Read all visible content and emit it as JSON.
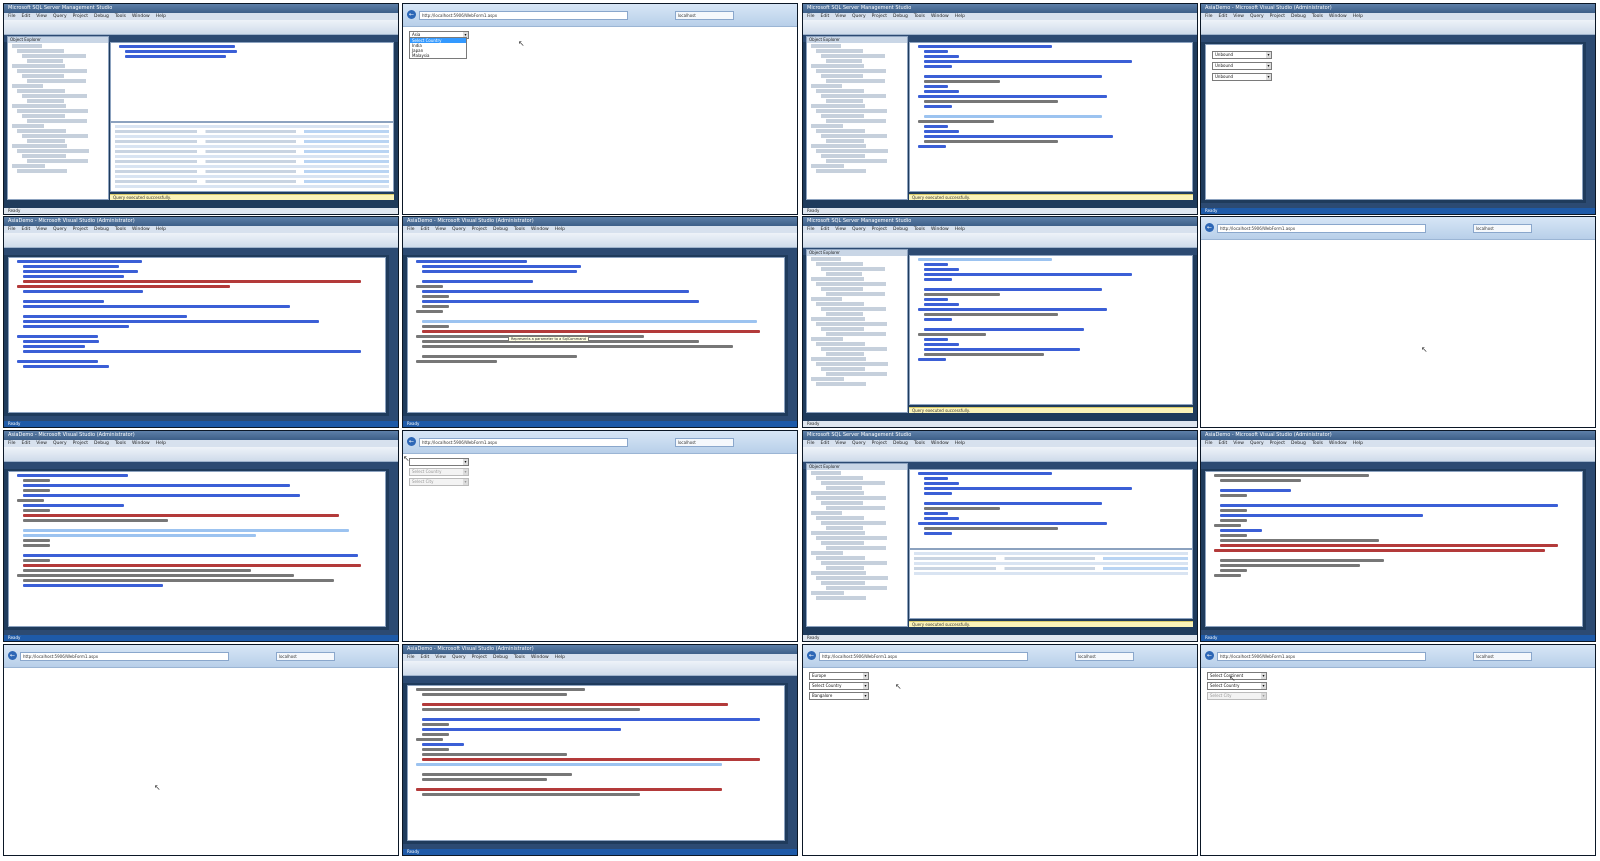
{
  "tiles": [
    {
      "app": "ssms",
      "title": "Microsoft SQL Server Management Studio",
      "tabs": [
        "SQLQuery1.sql - (local) Sample (PRAGIM\\Prashant (55))*"
      ],
      "code_lines": [
        "Select * from tblContinents",
        "Select * from tblCountries",
        "Select * from tblCities"
      ],
      "results_headers": [
        "ContinentId",
        "ContinentName"
      ],
      "results_rows": [
        [
          "1",
          "Asia"
        ],
        [
          "2",
          "Europe"
        ],
        [
          "3",
          "South America"
        ]
      ],
      "results2_headers": [
        "CountryId",
        "CountryName",
        "ContinentId"
      ],
      "results2_rows": [
        [
          "1",
          "India",
          "1"
        ],
        [
          "2",
          "Japan",
          "1"
        ],
        [
          "3",
          "Malaysia",
          "1"
        ],
        [
          "4",
          "United Kingdom",
          "2"
        ],
        [
          "5",
          "France",
          "2"
        ],
        [
          "6",
          "Germany",
          "2"
        ],
        [
          "7",
          "Argentina",
          "3"
        ],
        [
          "8",
          "Brazil",
          "3"
        ]
      ],
      "message": "Query executed successfully."
    },
    {
      "app": "browser",
      "address": "http://localhost:5906/WebForm1.aspx",
      "tab": "localhost",
      "ddl": [
        {
          "text": "Asia",
          "disabled": false
        }
      ],
      "list": [
        "Select Country",
        "India",
        "Japan",
        "Malaysia"
      ]
    },
    {
      "app": "ssms",
      "title": "Microsoft SQL Server Management Studio",
      "tabs": [
        "SQLQuery2.sql - (local).Sample (PRAGIM\\Prashant (52))*"
      ],
      "code_lines": [
        "Create Procedure spGetContinents",
        "as",
        "Begin",
        "Select ContinentId, ContinentName from tblContinents",
        "End",
        "",
        "Create Procedure spGetCountriesByContinentId",
        "@ContinentId int",
        "as",
        "Begin",
        "Select CountryId, CountryName from tblCountries",
        "where ContinentId = @ContinentId",
        "End",
        "",
        "Create Procedure spGetCountriesByContinentId",
        "@ContinentId int",
        "as",
        "Begin",
        "Select CountryId, CountryName from tblCountries",
        "where ContinentId = @ContinentId",
        "End"
      ],
      "message": "Query executed successfully."
    },
    {
      "app": "vs",
      "title": "AsiaDemo - Microsoft Visual Studio (Administrator)",
      "tabs": [
        "WebForm1.aspx",
        "WebForm1.aspx.cs"
      ],
      "design_ddl": [
        "Unbound",
        "Unbound",
        "Unbound"
      ]
    },
    {
      "app": "vs",
      "title": "AsiaDemo - Microsoft Visual Studio (Administrator)",
      "tabs": [
        "Web.config",
        "WebForm1.aspx.cs",
        "WebForm1.aspx"
      ],
      "code_lines": [
        "<?xml version=\"1.0\"?>",
        "<configuration>",
        "<connectionStrings>",
        "<add name=\"DBCS\"",
        "connectionString=\"data source=.; database = Sample; integrated security=SSPI\"",
        "providerName=\"System.Data.SqlClient\" />",
        "</connectionStrings>",
        "",
        "<system.web>",
        "<compilation debug=\"true\" targetFramework=\"4.0\" />",
        "",
        "<authentication mode=\"Forms\">",
        "<forms loginUrl=\"~/Account/Login.aspx\" timeout=\"2880\" />",
        "</authentication>",
        "",
        "<membership>",
        "<providers>",
        "<clear/>",
        "<add name=\"AspNetSqlMembershipProvider\" type=\"System.Web.Security.SqlMembershipProvider\"",
        "",
        "</providers>",
        "</membership>"
      ]
    },
    {
      "app": "vs",
      "title": "AsiaDemo - Microsoft Visual Studio (Administrator)",
      "tabs": [
        "WebForm1.aspx.cs",
        "WebForm1.aspx",
        "Web.config"
      ],
      "code_lines": [
        "using System.Data;",
        "using System.Data.SqlClient;",
        "using System.Configuration;",
        "",
        "namespace AsiaDemo",
        "{",
        "public partial class WebForm1 : System.Web.UI.Page",
        "{",
        "protected void Page_Load(object sender, EventArgs e)",
        "{",
        "}",
        "",
        "private DataSet GetData(string SPName, SqlParameter SPParameter)",
        "{",
        "string CS = ConfigurationManager.ConnectionStrings[\"DBCS\"].ConnectionString;",
        "SqlConnection con = new SqlConnection(CS);",
        "SqlDataAdapter da = new SqlDataAdapter(SPName, con);",
        "da.SelectCommand.CommandType = CommandType.StoredProcedure;",
        "",
        "DataSet DS = new DataSet();",
        "da.Fill(DS);"
      ],
      "tooltip": "Represents a parameter to a SqlCommand"
    },
    {
      "app": "ssms",
      "title": "Microsoft SQL Server Management Studio",
      "tabs": [
        "SQLQuery2.sql - (local).Sample (PRAGIM\\Prashant (52))*"
      ],
      "code_lines": [
        "Create Procedure spGetContinents",
        "as",
        "Begin",
        "Select ContinentId, ContinentName from tblContinents",
        "End",
        "",
        "Create Procedure spGetCountriesByContinentId",
        "@ContinentId int",
        "as",
        "Begin",
        "Select CountryId, CountryName from tblCountries",
        "where ContinentId = @ContinentId",
        "End",
        "",
        "Create Procedure spGetCitiesByCountryId",
        "@CountryId int",
        "as",
        "Begin",
        "Select CityId, CityName from tblCities",
        "where CountryId = @CountryId",
        "End"
      ],
      "message": "Query executed successfully."
    },
    {
      "app": "browser",
      "address": "http://localhost:5906/WebForm1.aspx",
      "tab": "localhost",
      "ddl": [],
      "list": []
    },
    {
      "app": "vs",
      "title": "AsiaDemo - Microsoft Visual Studio (Administrator)",
      "tabs": [
        "WebForm1.aspx.cs",
        "WebForm1.aspx"
      ],
      "code_lines": [
        "namespace AsiaDemo",
        "{",
        "public partial class WebForm1 : System.Web.UI.Page",
        "{",
        "protected void Page_Load(object sender, EventArgs e)",
        "{",
        "if (!IsPostBack)",
        "{",
        "ddlContinents.DataSource = GetData(\"spGetContinents\", null);",
        "ddlContinents.DataBind();",
        "",
        "ListItem liContinent = new ListItem(\"Select Continent\", \"-1\");",
        "ddlContinents.Items.Insert(0, liContinent);",
        "}",
        "}",
        "",
        "private DataSet GetData(string SPName, SqlParameter SPParameter)",
        "{",
        "string CS = ConfigurationManager.ConnectionStrings[\"DBCS\"].ConnectionString;",
        "SqlConnection con = new SqlConnection(CS);",
        "SqlDataAdapter da = new SqlDataAdapter(SPName, con);",
        "da.SelectCommand.CommandType = CommandType.StoredProcedure;",
        "if (SPParameter != null)"
      ]
    },
    {
      "app": "browser",
      "address": "http://localhost:5906/WebForm1.aspx",
      "tab": "localhost",
      "ddl": [
        {
          "text": "",
          "disabled": false
        },
        {
          "text": "Select Country",
          "disabled": true
        },
        {
          "text": "Select City",
          "disabled": true
        }
      ],
      "list": []
    },
    {
      "app": "ssms",
      "title": "Microsoft SQL Server Management Studio",
      "tabs": [
        "SQLQuery2.sql - (local).Sample (PRAGIM\\Prashant (52))*"
      ],
      "code_lines": [
        "Create Procedure spGetContinents",
        "as",
        "Begin",
        "Select ContinentId, ContinentName from tblContinents",
        "End",
        "",
        "Create Procedure spGetCountriesByContinentId",
        "@ContinentId int",
        "as",
        "Begin",
        "Select CountryId, CountryName from tblCountries",
        "where ContinentId = @ContinentId",
        "End"
      ],
      "results_headers": [
        "ContinentId",
        "ContinentName"
      ],
      "results_rows": [
        [
          "1",
          "Asia"
        ],
        [
          "2",
          "Europe"
        ],
        [
          "3",
          "South America"
        ]
      ],
      "message": "Query executed successfully."
    },
    {
      "app": "vs",
      "title": "AsiaDemo - Microsoft Visual Studio (Administrator)",
      "tabs": [
        "WebForm1.aspx.cs",
        "WebForm1.aspx"
      ],
      "code_lines": [
        "DataSet DS = new DataSet();",
        "da.Fill(DS);",
        "",
        "return DS;",
        "}",
        "",
        "protected void ddlContinents_SelectedIndexChanged(object sender, EventArgs e)",
        "{",
        "if (ddlContinents.SelectedIndex == 0)",
        "{",
        "}",
        "else",
        "{",
        "ddlCountries.Enabled = true;",
        "SqlParameter parameter = new SqlParameter(\"@ContinentId\", ddlContinents.SelectedValue);",
        "DataSet DS = GetData(\"spGetCountriesByContinentId\", parameter);",
        "",
        "ddlCountries.DataSource = DS;",
        "ddlCountries.DataBind();",
        "}",
        "}"
      ]
    },
    {
      "app": "browser",
      "address": "http://localhost:5906/WebForm1.aspx",
      "tab": "localhost",
      "ddl": [],
      "list": []
    },
    {
      "app": "vs",
      "title": "AsiaDemo - Microsoft Visual Studio (Administrator)",
      "tabs": [
        "WebForm1.aspx.cs",
        "WebForm1.aspx"
      ],
      "code_lines": [
        "ddlContinents.DataSource = DS;",
        "ddlContinents.DataBind();",
        "",
        "ListItem liCountry = new ListItem(\"Select Country\", \"-1\");",
        "ddlCountries.Items.Insert(0, liCountry);",
        "",
        "protected void ddlCountries_SelectedIndexChanged(object sender, EventArgs e)",
        "{",
        "if (ddlCountries.SelectedIndex == 0)",
        "{",
        "}",
        "else",
        "{",
        "ddlCities.Enabled = true;",
        "SqlParameter parameter = new SqlParameter(\"@CountryId\", ddlCountries.SelectedValue);",
        "DataSet DS = GetData(\"spGetCitiesByCountryId\", parameter);",
        "",
        "ddlCities.DataSource = DS;",
        "ddlCities.DataBind();",
        "",
        "ListItem liCountry = new ListItem(\"Select Country\", \"-1\");",
        "ddlCountries.Items.Insert(0, liCountry);"
      ]
    },
    {
      "app": "browser",
      "address": "http://localhost:5906/WebForm1.aspx",
      "tab": "localhost",
      "ddl": [
        {
          "text": "Europe",
          "disabled": false
        },
        {
          "text": "Select Country",
          "disabled": false
        },
        {
          "text": "Bangalore",
          "disabled": false
        }
      ],
      "list": []
    },
    {
      "app": "browser",
      "address": "http://localhost:5906/WebForm1.aspx",
      "tab": "localhost",
      "ddl": [
        {
          "text": "Select Continent",
          "disabled": false
        },
        {
          "text": "Select Country",
          "disabled": false
        },
        {
          "text": "Select City",
          "disabled": true
        }
      ],
      "list": []
    }
  ],
  "colors": {
    "vs_frame": "#1f3b5c",
    "vs_status": "#1e5aa8",
    "ssms_message": "#fbf3b8",
    "selection": "#9cc3f0",
    "keyword": "#3b5fd6",
    "string": "#b33a3a"
  }
}
